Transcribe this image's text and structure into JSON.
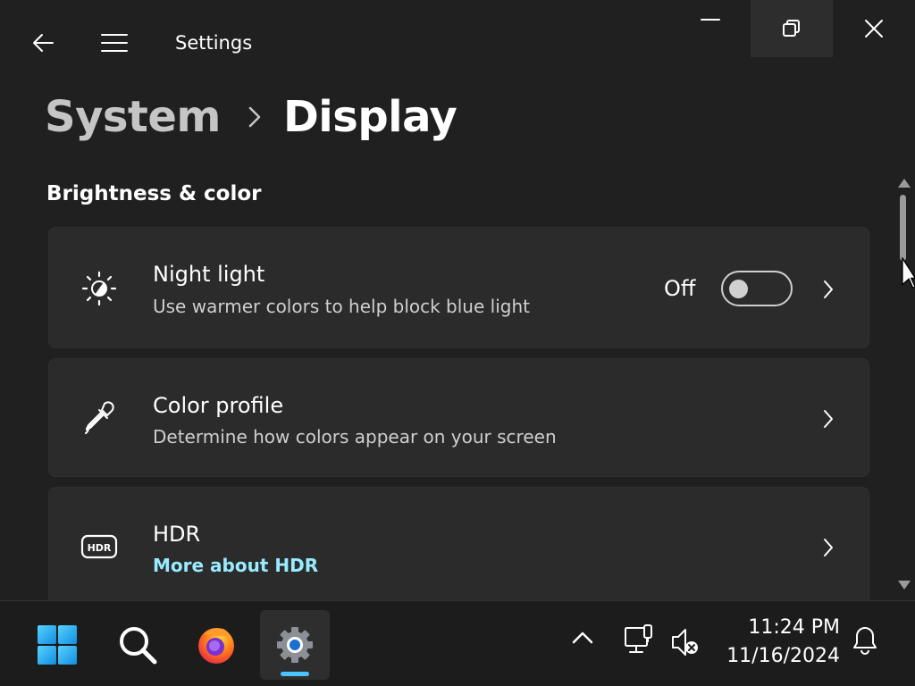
{
  "window": {
    "title": "Settings",
    "controls": {
      "minimize": "minimize-icon",
      "restore": "restore-icon",
      "close": "close-icon"
    }
  },
  "breadcrumb": {
    "parent": "System",
    "current": "Display"
  },
  "section": {
    "title": "Brightness & color"
  },
  "cards": [
    {
      "icon": "brightness-icon",
      "title": "Night light",
      "subtitle": "Use warmer colors to help block blue light",
      "toggle_label": "Off",
      "toggle_on": false
    },
    {
      "icon": "eyedropper-icon",
      "title": "Color profile",
      "subtitle": "Determine how colors appear on your screen"
    },
    {
      "icon": "hdr-icon",
      "title": "HDR",
      "link": "More about HDR"
    }
  ],
  "taskbar": {
    "apps": [
      "windows-start-icon",
      "search-icon",
      "firefox-icon",
      "settings-icon"
    ],
    "active_app": "settings-icon",
    "tray": [
      "chevron-up-icon",
      "network-icon",
      "volume-muted-icon",
      "notification-bell-icon"
    ],
    "time": "11:24 PM",
    "date": "11/16/2024"
  },
  "colors": {
    "background": "#202020",
    "card": "#2b2b2b",
    "accent": "#4cc2ff",
    "link": "#99ebff"
  }
}
